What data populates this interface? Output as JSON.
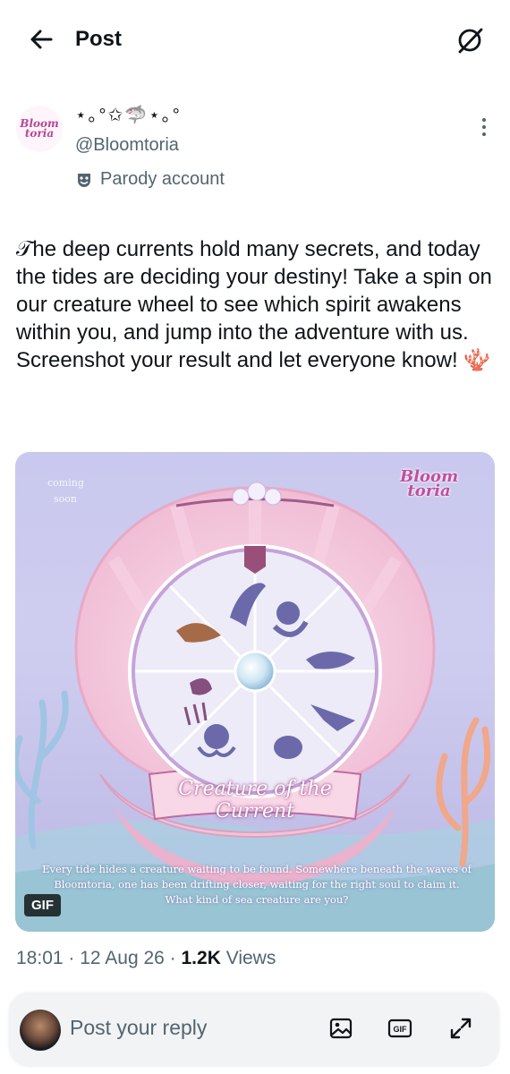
{
  "header": {
    "title": "Post"
  },
  "author": {
    "display_name": "⋆｡°✩🦈⋆｡°",
    "handle": "@Bloomtoria",
    "label": "Parody account",
    "avatar_logo": [
      "Bloom",
      "toria"
    ]
  },
  "post": {
    "text": "𝒯he deep currents hold many secrets, and today the tides are deciding your destiny! Take a spin on our creature wheel to see which spirit awakens within you, and jump into the adventure with us. Screenshot your result and let everyone know! 🪸"
  },
  "media": {
    "badge": "GIF",
    "coming_text": "coming soon",
    "logo": [
      "Bloom",
      "toria"
    ],
    "banner": "Creature of the Current",
    "caption": "Every tide hides a creature waiting to be found. Somewhere beneath the waves of Bloomtoria, one has been drifting closer, waiting for the right soul to claim it. What kind of sea creature are you?",
    "wheel_segments": [
      "dolphin",
      "seal",
      "whale",
      "manta-ray",
      "turtle",
      "octopus",
      "jellyfish",
      "shell"
    ]
  },
  "meta": {
    "time": "18:01",
    "date": "12 Aug 26",
    "views_count": "1.2K",
    "views_label": "Views"
  },
  "reply": {
    "placeholder": "Post your reply"
  },
  "colors": {
    "accent": "#1d9bf0",
    "text": "#0f1419",
    "muted": "#536471",
    "brand_pink": "#c04f9f"
  }
}
